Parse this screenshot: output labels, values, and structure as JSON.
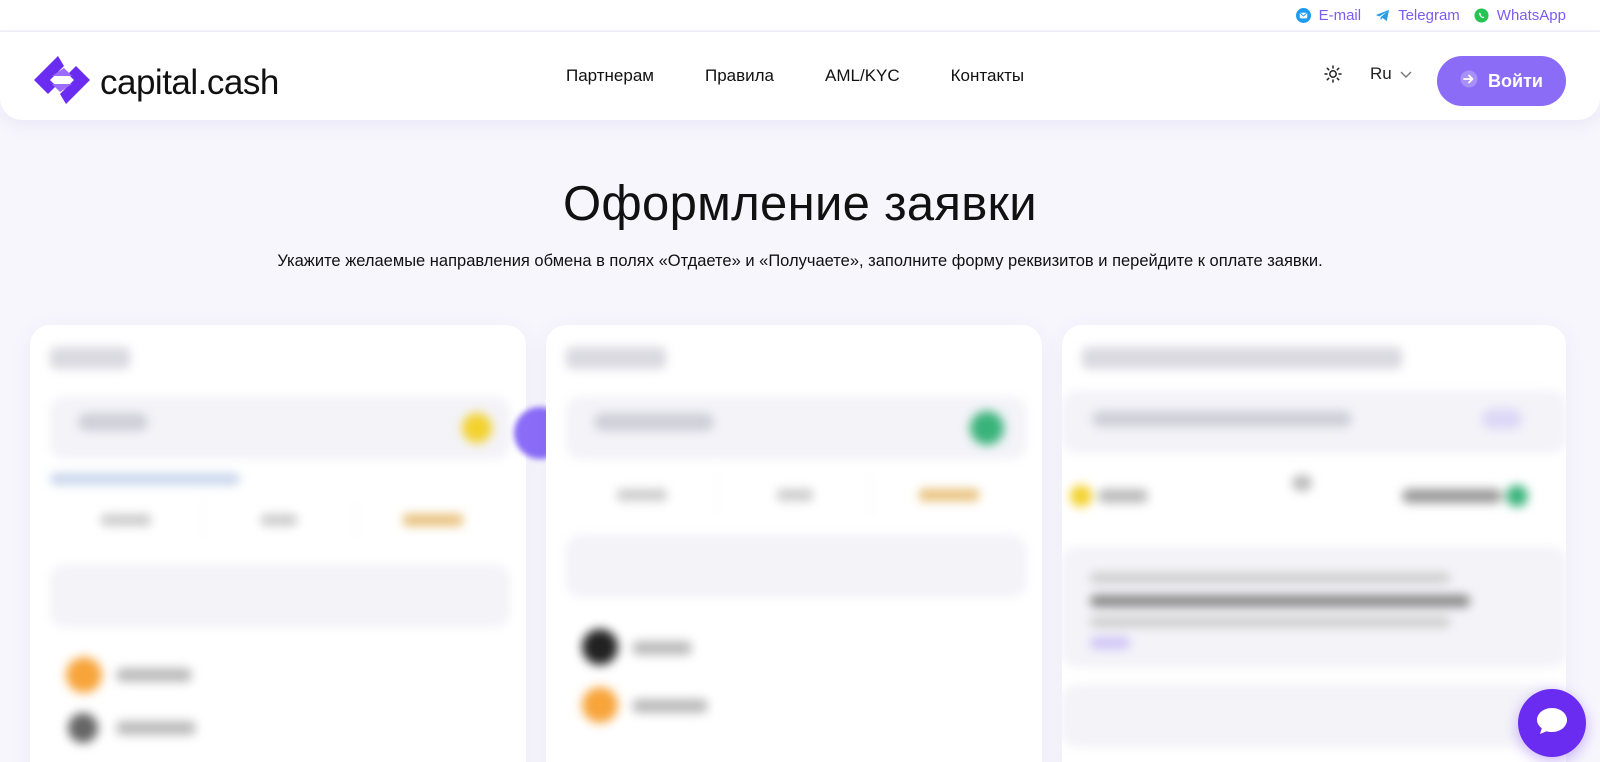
{
  "contacts": [
    {
      "label": "E-mail",
      "icon": "email-icon"
    },
    {
      "label": "Telegram",
      "icon": "telegram-icon"
    },
    {
      "label": "WhatsApp",
      "icon": "whatsapp-icon"
    }
  ],
  "brand": {
    "name": "capital.cash",
    "color": "#6a2cf0",
    "accent": "#8a6cf7"
  },
  "nav": [
    {
      "label": "Партнерам"
    },
    {
      "label": "Правила"
    },
    {
      "label": "AML/KYC"
    },
    {
      "label": "Контакты"
    }
  ],
  "header": {
    "theme_icon": "sun-icon",
    "language": "Ru",
    "login_label": "Войти",
    "login_icon": "login-arrow-icon"
  },
  "hero": {
    "title": "Оформление заявки",
    "subtitle": "Укажите желаемые направления обмена в полях «Отдаете» и «Получаете», заполните форму реквизитов и перейдите к оплате заявки."
  },
  "chat": {
    "icon": "chat-bubble-icon"
  }
}
